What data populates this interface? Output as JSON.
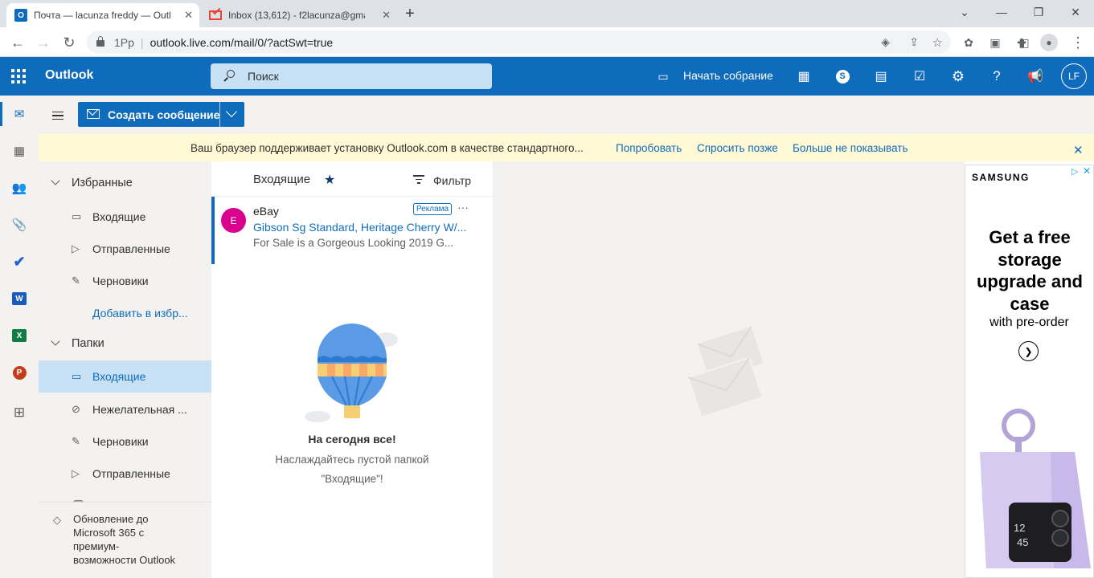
{
  "browser": {
    "tabs": [
      {
        "title": "Почта — lacunza freddy — Outlo",
        "active": true,
        "icon": "outlook-icon"
      },
      {
        "title": "Inbox (13,612) - f2lacunza@gmai",
        "active": false,
        "icon": "gmail-icon"
      }
    ],
    "new_tab": "+",
    "site_info": "1Pp",
    "url": "outlook.live.com/mail/0/?actSwt=true"
  },
  "header": {
    "app_name": "Outlook",
    "search_placeholder": "Поиск",
    "meet_now": "Начать собрание",
    "avatar_initials": "LF"
  },
  "commands": {
    "compose_label": "Создать сообщение"
  },
  "banner": {
    "message": "Ваш браузер поддерживает установку Outlook.com в качестве стандартного...",
    "try": "Попробовать",
    "ask_later": "Спросить позже",
    "dont_show": "Больше не показывать"
  },
  "folders": {
    "favorites_title": "Избранные",
    "favorites": [
      {
        "label": "Входящие",
        "icon": "inbox-icon"
      },
      {
        "label": "Отправленные",
        "icon": "sent-icon"
      },
      {
        "label": "Черновики",
        "icon": "drafts-icon"
      }
    ],
    "add_favorite": "Добавить в избр...",
    "folders_title": "Папки",
    "items": [
      {
        "label": "Входящие",
        "icon": "inbox-icon",
        "selected": true
      },
      {
        "label": "Нежелательная ...",
        "icon": "junk-icon"
      },
      {
        "label": "Черновики",
        "icon": "drafts-icon"
      },
      {
        "label": "Отправленные",
        "icon": "sent-icon"
      }
    ]
  },
  "upgrade": {
    "line1": "Обновление до",
    "line2": "Microsoft 365 с",
    "line3": "премиум-",
    "line4": "возможности Outlook"
  },
  "message_list": {
    "title": "Входящие",
    "filter": "Фильтр",
    "ad_message": {
      "avatar": "E",
      "sender": "eBay",
      "badge": "Реклама",
      "subject": "Gibson Sg Standard, Heritage Cherry W/...",
      "preview": "For Sale is a Gorgeous Looking 2019 G..."
    },
    "empty_title": "На сегодня все!",
    "empty_line1": "Наслаждайтесь пустой папкой",
    "empty_line2": "\"Входящие\"!"
  },
  "ad": {
    "brand": "SAMSUNG",
    "headline": "Get a free storage upgrade and case",
    "sub": "with pre-order",
    "phone_time_h": "12",
    "phone_time_m": "45"
  },
  "colors": {
    "brand_blue": "#0f6cbd",
    "link_blue": "#0f6cbd",
    "selected_bg": "#c7e0f4",
    "banner_bg": "#fff9d6"
  }
}
